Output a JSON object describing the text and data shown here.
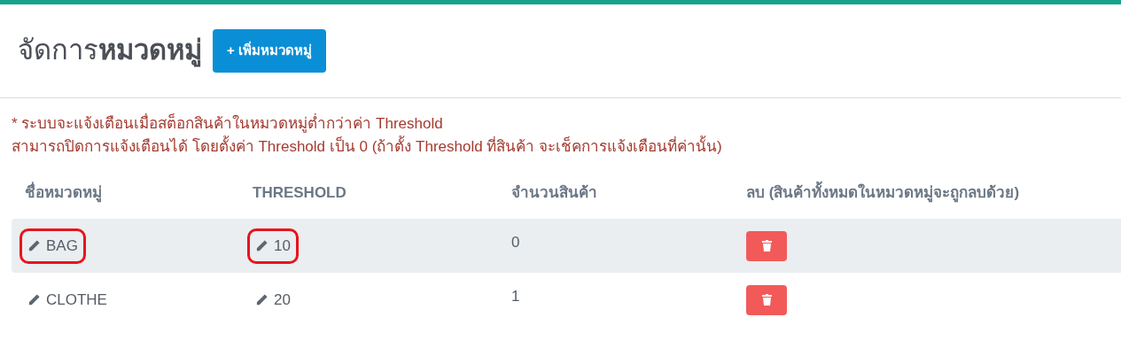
{
  "title": {
    "plain": "จัดการ",
    "bold": "หมวดหมู่"
  },
  "add_button": "+ เพิ่มหมวดหมู่",
  "notes": [
    "* ระบบจะแจ้งเตือนเมื่อสต็อกสินค้าในหมวดหมู่ต่ำกว่าค่า Threshold",
    "สามารถปิดการแจ้งเตือนได้ โดยตั้งค่า Threshold เป็น 0 (ถ้าตั้ง Threshold ที่สินค้า จะเช็คการแจ้งเตือนที่ค่านั้น)"
  ],
  "table": {
    "columns": [
      "ชื่อหมวดหมู่",
      "THRESHOLD",
      "จำนวนสินค้า",
      "ลบ (สินค้าทั้งหมดในหมวดหมู่จะถูกลบด้วย)"
    ],
    "rows": [
      {
        "highlighted": true,
        "name": {
          "text": "BAG",
          "circled": true
        },
        "threshold": {
          "text": "10",
          "circled": true
        },
        "count": "0"
      },
      {
        "highlighted": false,
        "name": {
          "text": "CLOTHE",
          "circled": false
        },
        "threshold": {
          "text": "20",
          "circled": false
        },
        "count": "1"
      }
    ]
  }
}
